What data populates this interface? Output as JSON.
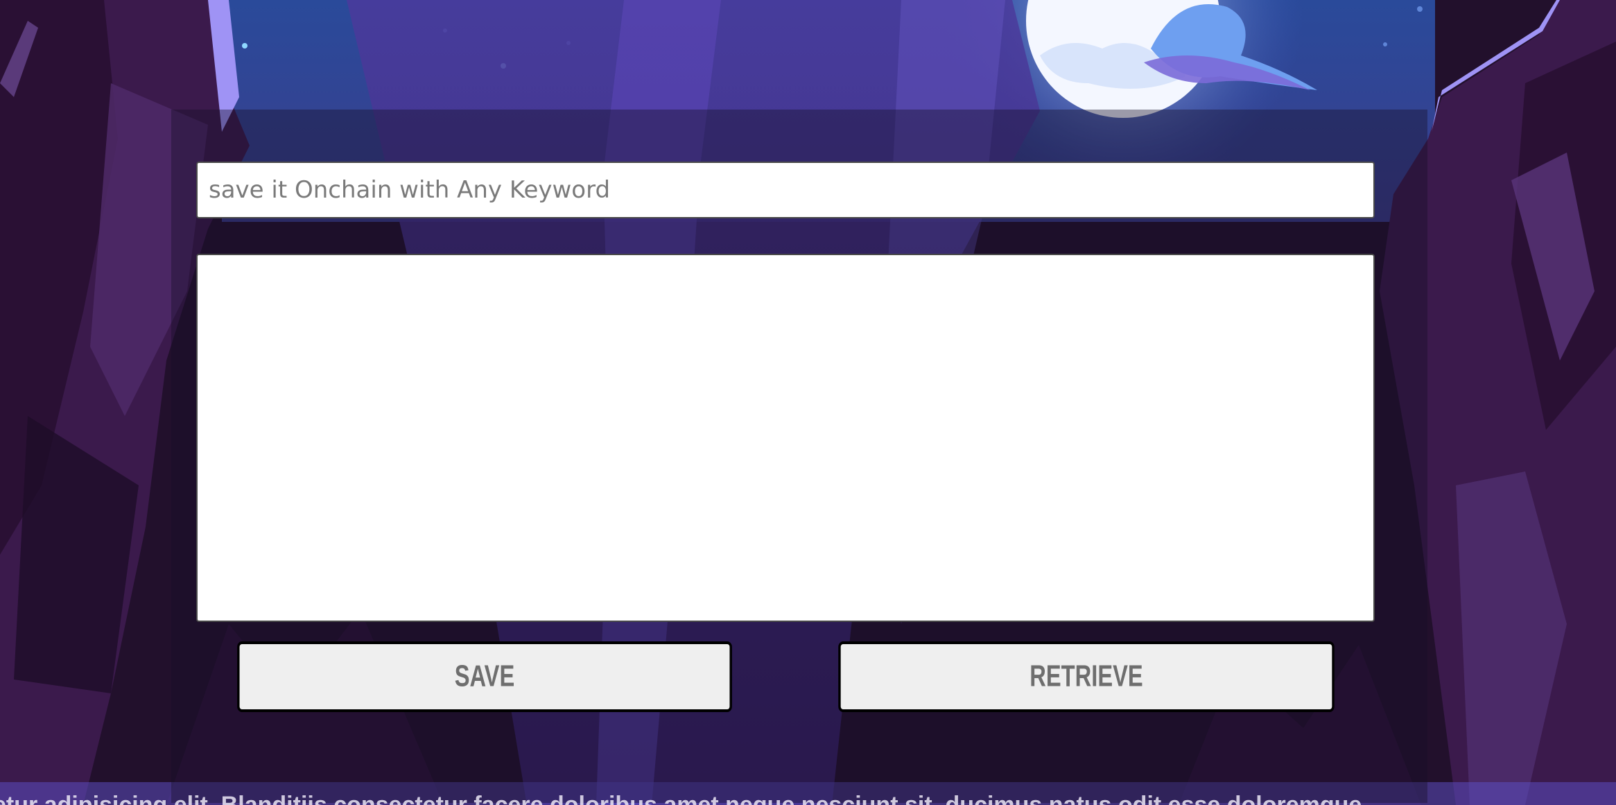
{
  "form": {
    "keyword_placeholder": "save it Onchain with Any Keyword",
    "keyword_value": "",
    "content_value": "",
    "save_label": "SAVE",
    "retrieve_label": "RETRIEVE"
  },
  "ticker": {
    "text": "etur adipisicing elit. Blanditiis consectetur facere doloribus amet neque nesciunt sit, ducimus natus odit esse doloremque"
  },
  "colors": {
    "sky": "#2f4fa0",
    "moon": "#f2f6ff",
    "rock_dark": "#2a1233",
    "rock_mid": "#4b2a6e",
    "rock_light": "#6a4aa8",
    "input_bg": "#ffffff",
    "button_bg": "#efefef",
    "button_text": "#6e6e6e",
    "button_border": "#000000"
  }
}
